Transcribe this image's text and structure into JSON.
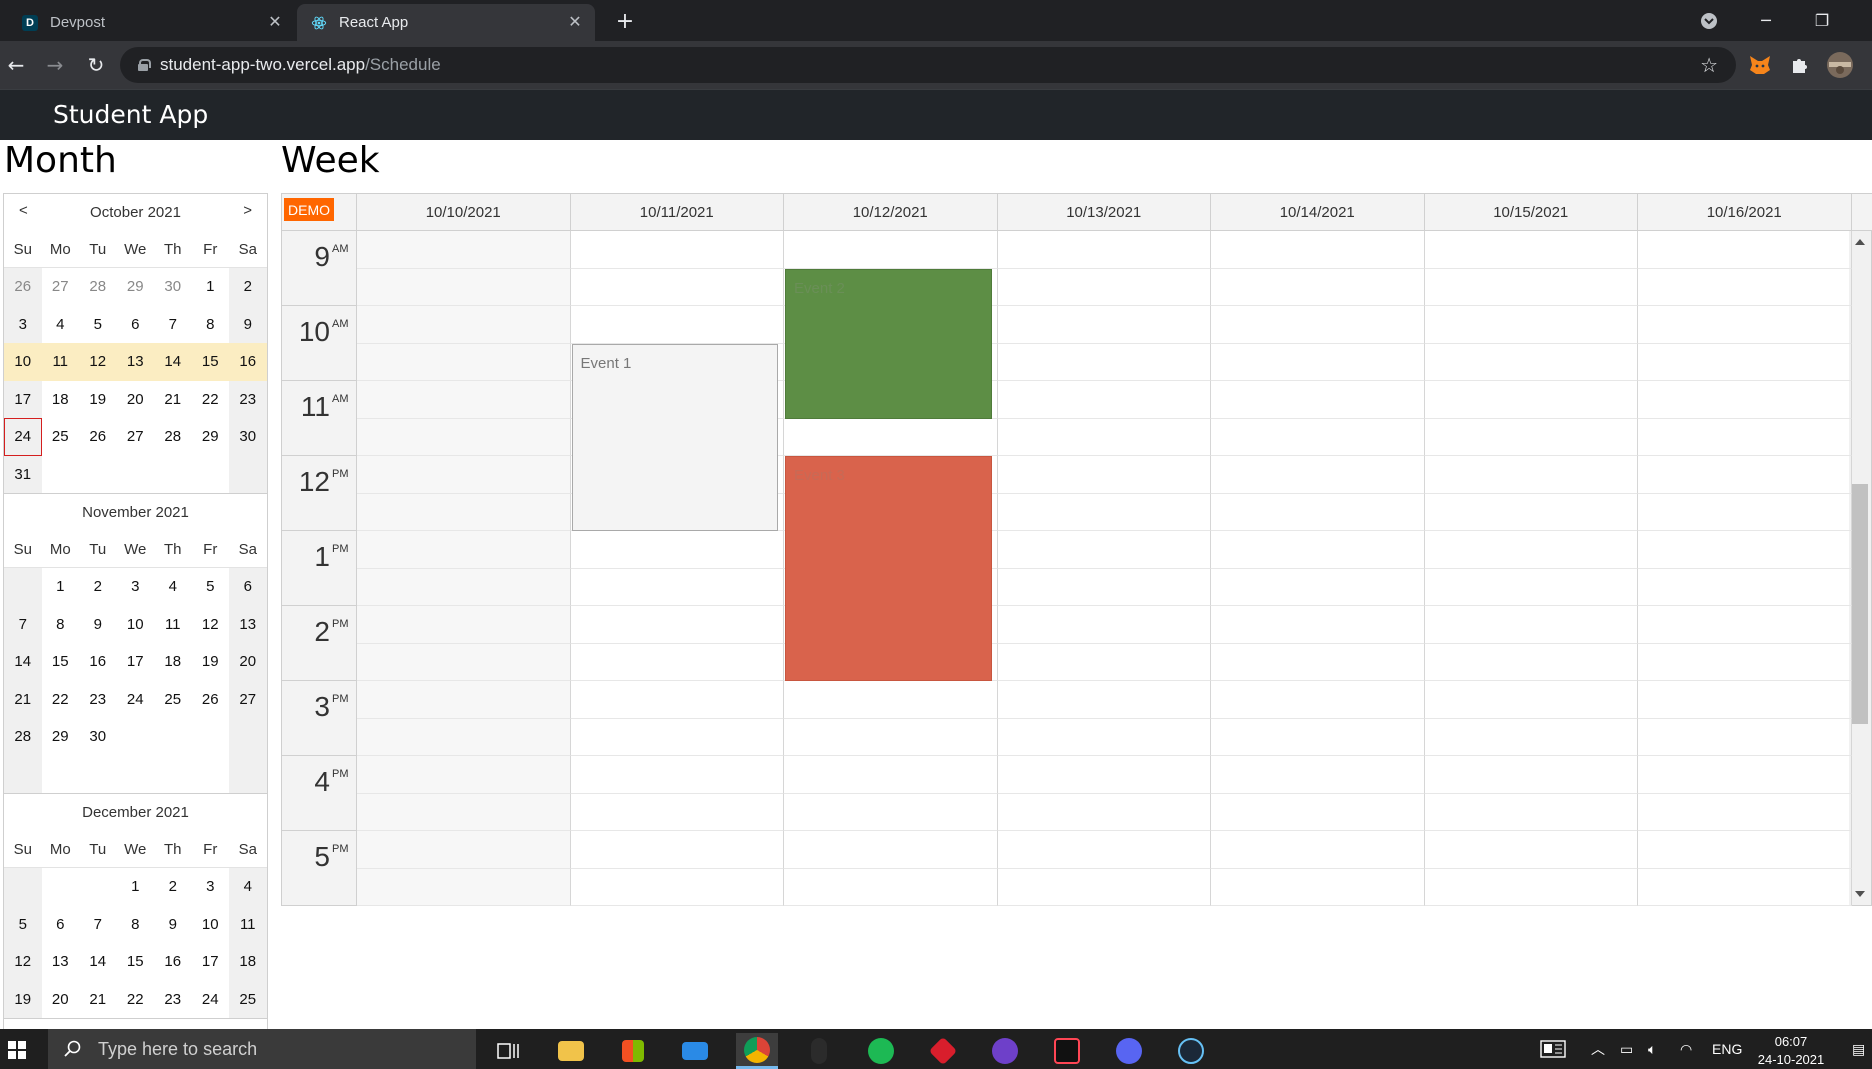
{
  "browser": {
    "tabs": [
      {
        "title": "Devpost",
        "favicon": "D",
        "favicon_color": "#003e54"
      },
      {
        "title": "React App",
        "favicon": "react-logo",
        "favicon_color": "#61dafb"
      }
    ],
    "url_host": "student-app-two.vercel.app",
    "url_path": "/Schedule"
  },
  "app": {
    "brand": "Student App",
    "month_heading": "Month",
    "week_heading": "Week"
  },
  "navigator": {
    "day_names": [
      "Su",
      "Mo",
      "Tu",
      "We",
      "Th",
      "Fr",
      "Sa"
    ],
    "prev_label": "<",
    "next_label": ">",
    "months": [
      {
        "title": "October 2021",
        "weeks": [
          [
            "26",
            "27",
            "28",
            "29",
            "30",
            "1",
            "2"
          ],
          [
            "3",
            "4",
            "5",
            "6",
            "7",
            "8",
            "9"
          ],
          [
            "10",
            "11",
            "12",
            "13",
            "14",
            "15",
            "16"
          ],
          [
            "17",
            "18",
            "19",
            "20",
            "21",
            "22",
            "23"
          ],
          [
            "24",
            "25",
            "26",
            "27",
            "28",
            "29",
            "30"
          ],
          [
            "31",
            "",
            "",
            "",
            "",
            "",
            ""
          ]
        ]
      },
      {
        "title": "November 2021",
        "weeks": [
          [
            "",
            "1",
            "2",
            "3",
            "4",
            "5",
            "6"
          ],
          [
            "7",
            "8",
            "9",
            "10",
            "11",
            "12",
            "13"
          ],
          [
            "14",
            "15",
            "16",
            "17",
            "18",
            "19",
            "20"
          ],
          [
            "21",
            "22",
            "23",
            "24",
            "25",
            "26",
            "27"
          ],
          [
            "28",
            "29",
            "30",
            "",
            "",
            "",
            ""
          ],
          [
            "",
            "",
            "",
            "",
            "",
            "",
            ""
          ]
        ]
      },
      {
        "title": "December 2021",
        "weeks": [
          [
            "",
            "",
            "",
            "1",
            "2",
            "3",
            "4"
          ],
          [
            "5",
            "6",
            "7",
            "8",
            "9",
            "10",
            "11"
          ],
          [
            "12",
            "13",
            "14",
            "15",
            "16",
            "17",
            "18"
          ],
          [
            "19",
            "20",
            "21",
            "22",
            "23",
            "24",
            "25"
          ]
        ]
      }
    ],
    "selected_week": "10/10/2021 - 10/16/2021",
    "today": "24"
  },
  "calendar": {
    "badge": "DEMO",
    "columns": [
      "10/10/2021",
      "10/11/2021",
      "10/12/2021",
      "10/13/2021",
      "10/14/2021",
      "10/15/2021",
      "10/16/2021"
    ],
    "hours": [
      {
        "h": "9",
        "ap": "AM"
      },
      {
        "h": "10",
        "ap": "AM"
      },
      {
        "h": "11",
        "ap": "AM"
      },
      {
        "h": "12",
        "ap": "PM"
      },
      {
        "h": "1",
        "ap": "PM"
      },
      {
        "h": "2",
        "ap": "PM"
      },
      {
        "h": "3",
        "ap": "PM"
      },
      {
        "h": "4",
        "ap": "PM"
      },
      {
        "h": "5",
        "ap": "PM"
      }
    ],
    "events": [
      {
        "text": "Event 1",
        "day": 1,
        "start": "10:30",
        "end": "13:00",
        "bg": "#f4f4f4",
        "color": "#777777",
        "border": "#a9a9a9"
      },
      {
        "text": "Event 2",
        "day": 2,
        "start": "09:30",
        "end": "11:30",
        "bg": "#5d8e45",
        "color": "#6a8f57",
        "border": "#4f7b3a"
      },
      {
        "text": "Event 3",
        "day": 2,
        "start": "12:00",
        "end": "15:00",
        "bg": "#d9634c",
        "color": "#c76a56",
        "border": "#c8563f"
      }
    ]
  },
  "taskbar": {
    "search_placeholder": "Type here to search",
    "lang": "ENG",
    "time": "06:07",
    "date": "24-10-2021"
  }
}
